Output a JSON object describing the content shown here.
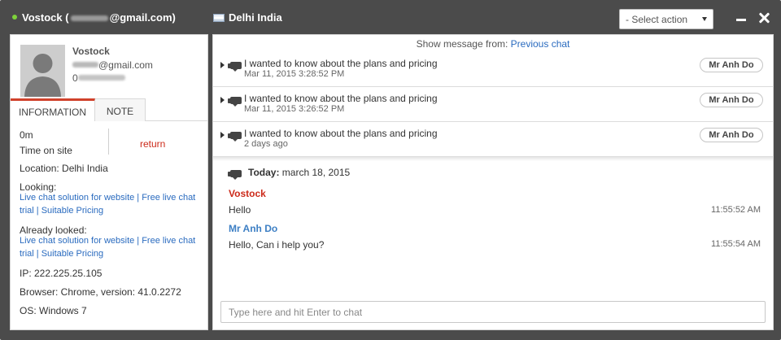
{
  "titlebar": {
    "visitor_prefix": "Vostock (",
    "visitor_suffix": "@gmail.com)",
    "location": "Delhi India",
    "select_action": "- Select action"
  },
  "visitor": {
    "name": "Vostock",
    "email_suffix": "@gmail.com",
    "phone_prefix": "0"
  },
  "tabs": {
    "information": "INFORMATION",
    "note": "NOTE"
  },
  "info": {
    "time_value": "0m",
    "time_label": "Time on site",
    "return_label": "return",
    "location": "Location: Delhi India",
    "looking_label": "Looking:",
    "looking_links": "Live chat solution for website | Free live chat trial | Suitable Pricing",
    "looked_label": "Already looked:",
    "looked_links": "Live chat solution for website | Free live chat trial | Suitable Pricing",
    "ip": "IP: 222.225.25.105",
    "browser": "Browser: Chrome, version: 41.0.2272",
    "os": "OS: Windows 7"
  },
  "chat": {
    "show_message_label": "Show message from:",
    "previous_chat": "Previous chat",
    "history": [
      {
        "subject": "I wanted to know about the plans and pricing",
        "date": "Mar 11, 2015 3:28:52 PM",
        "agent": "Mr Anh Do"
      },
      {
        "subject": "I wanted to know about the plans and pricing",
        "date": "Mar 11, 2015 3:26:52 PM",
        "agent": "Mr Anh Do"
      },
      {
        "subject": "I wanted to know about the plans and pricing",
        "date": "2 days ago",
        "agent": "Mr Anh Do"
      }
    ],
    "today_label": "Today:",
    "today_date": "march 18, 2015",
    "messages": [
      {
        "sender": "Vostock",
        "text": "Hello",
        "time": "11:55:52 AM"
      },
      {
        "sender": "Mr Anh Do",
        "text": "Hello, Can i help you?",
        "time": "11:55:54 AM"
      }
    ],
    "input_placeholder": "Type here and hit Enter to chat"
  },
  "icons": [
    "online-status-icon",
    "flag-icon",
    "caret-down-icon",
    "minimize-icon",
    "close-icon",
    "avatar-icon",
    "expand-triangle-icon",
    "chat-bubble-icon"
  ],
  "colors": {
    "titlebar_bg": "#4b4b4b",
    "tab_accent": "#d0412b",
    "visitor_name": "#cc2a1a",
    "agent_name": "#3d7fc4",
    "link": "#2a6bbf",
    "online": "#7ed23a"
  }
}
